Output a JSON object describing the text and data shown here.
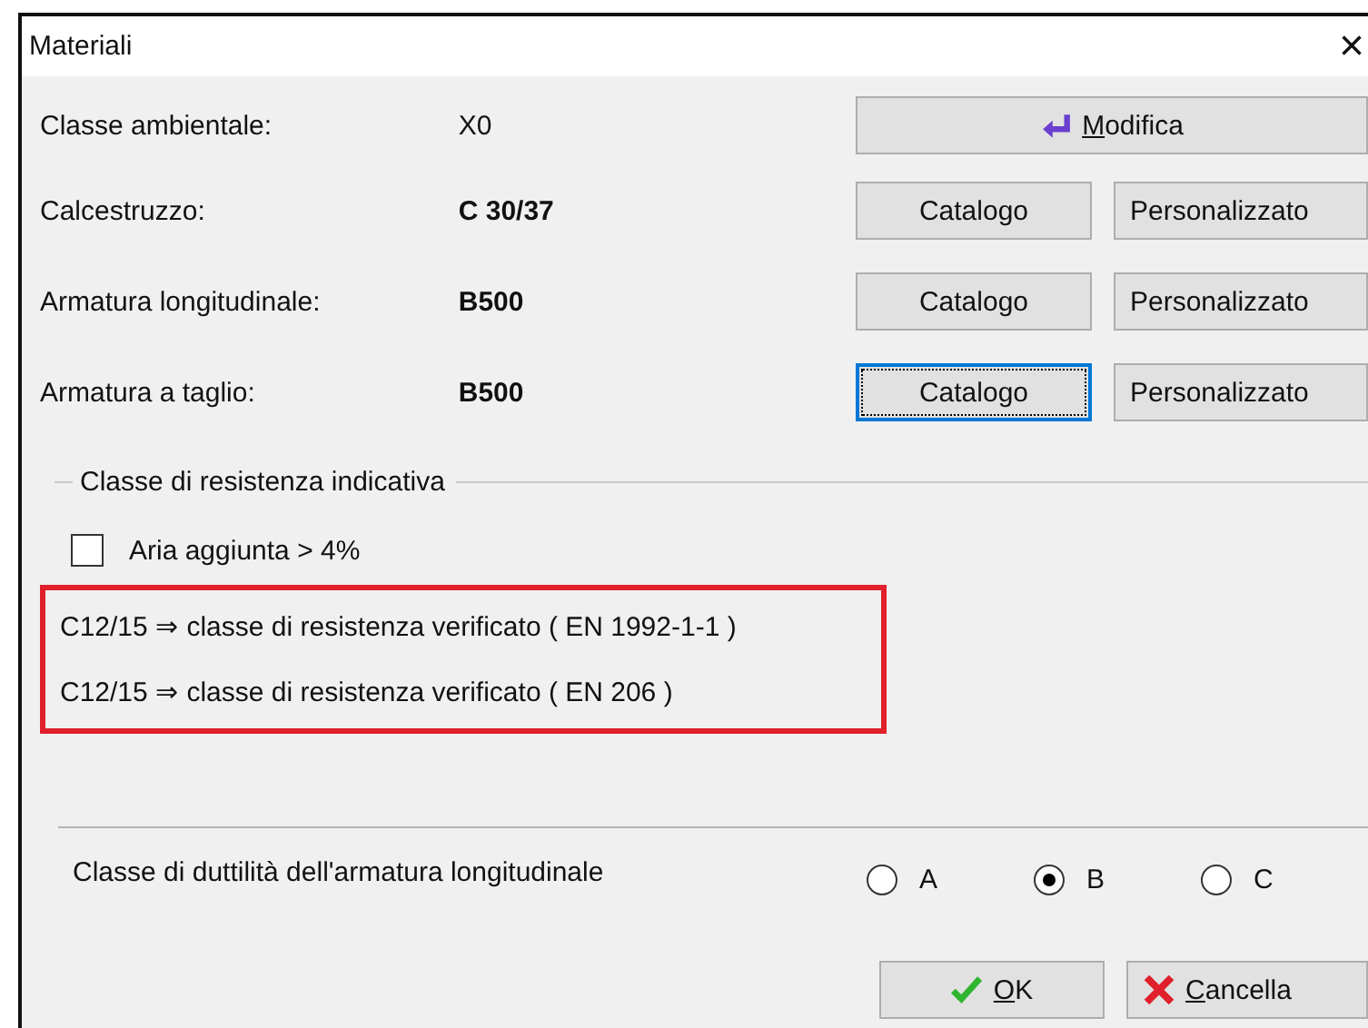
{
  "window": {
    "title": "Materiali",
    "close": "×"
  },
  "rows": [
    {
      "label": "Classe ambientale:",
      "value": "X0",
      "bold": false,
      "buttons": [
        {
          "kind": "modify",
          "label": "Modifica",
          "underline_first": true,
          "focused": false
        }
      ]
    },
    {
      "label": "Calcestruzzo:",
      "value": "C 30/37",
      "bold": true,
      "buttons": [
        {
          "kind": "plain",
          "label": "Catalogo",
          "underline_first": false,
          "focused": false
        },
        {
          "kind": "plain",
          "label": "Personalizzato",
          "underline_first": false,
          "focused": false
        }
      ]
    },
    {
      "label": "Armatura longitudinale:",
      "value": "B500",
      "bold": true,
      "buttons": [
        {
          "kind": "plain",
          "label": "Catalogo",
          "underline_first": false,
          "focused": false
        },
        {
          "kind": "plain",
          "label": "Personalizzato",
          "underline_first": false,
          "focused": false
        }
      ]
    },
    {
      "label": "Armatura a taglio:",
      "value": "B500",
      "bold": true,
      "buttons": [
        {
          "kind": "plain",
          "label": "Catalogo",
          "underline_first": false,
          "focused": true
        },
        {
          "kind": "plain",
          "label": "Personalizzato",
          "underline_first": false,
          "focused": false
        }
      ]
    }
  ],
  "group": {
    "title": "Classe di resistenza indicativa",
    "checkbox": {
      "label": "Aria aggiunta > 4%",
      "checked": false
    },
    "results_highlighted": true,
    "results": [
      "C12/15 ⇒ classe di resistenza verificato ( EN 1992-1-1 )",
      "C12/15 ⇒ classe di resistenza verificato ( EN 206 )"
    ]
  },
  "ductility": {
    "label": "Classe di duttilità dell'armatura longitudinale",
    "options": [
      {
        "label": "A",
        "selected": false
      },
      {
        "label": "B",
        "selected": true
      },
      {
        "label": "C",
        "selected": false
      }
    ]
  },
  "footer_buttons": [
    {
      "kind": "ok",
      "label": "OK",
      "underline_first": true
    },
    {
      "kind": "cancel",
      "label": "Cancella",
      "underline_first": true
    }
  ]
}
